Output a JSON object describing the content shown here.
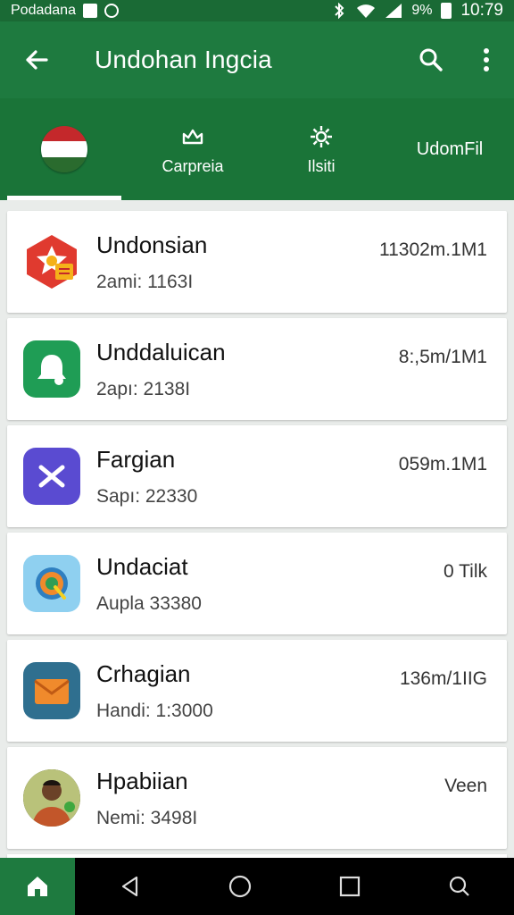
{
  "status_bar": {
    "carrier": "Podadana",
    "battery": "9%",
    "time": "10:79"
  },
  "app_bar": {
    "title": "Undohan Ingcia",
    "back_icon": "arrow-left-icon",
    "search_icon": "search-icon",
    "menu_icon": "more-vert-icon"
  },
  "tabs": [
    {
      "label": "",
      "icon": "flag-icon",
      "active": true
    },
    {
      "label": "Carpreia",
      "icon": "crown-icon",
      "active": false
    },
    {
      "label": "Ilsiti",
      "icon": "gear-icon",
      "active": false
    },
    {
      "label": "UdomFil",
      "icon": "",
      "active": false
    }
  ],
  "items": [
    {
      "name": "Undonsian",
      "sub": "2ami: 1163I",
      "value": "11302m.1M1",
      "icon": "star-badge-icon",
      "color": "#e03a2f"
    },
    {
      "name": "Unddaluican",
      "sub": "2apı: 2138I",
      "value": "8:,5m/1M1",
      "icon": "bell-icon",
      "color": "#1f9d55"
    },
    {
      "name": "Fargian",
      "sub": "Sapı: 22330",
      "value": "059m.1M1",
      "icon": "cross-arrow-icon",
      "color": "#5a4bd1"
    },
    {
      "name": "Undaciat",
      "sub": "Aupla 33380",
      "value": "0 Tilk",
      "icon": "target-icon",
      "color": "#5bb7e6"
    },
    {
      "name": "Crhagian",
      "sub": "Handi: 1:3000",
      "value": "136m/1IIG",
      "icon": "envelope-icon",
      "color": "#2f6f8f"
    },
    {
      "name": "Hpabiian",
      "sub": "Nemi: 3498I",
      "value": "Veen",
      "icon": "avatar-photo",
      "color": "#3a3a2a"
    }
  ],
  "colors": {
    "primary": "#1e7a3f",
    "primary_dark": "#1a6a35"
  },
  "nav": {
    "home": "home-icon",
    "back": "nav-back-icon",
    "home_circle": "nav-home-circle-icon",
    "recents": "nav-recents-icon",
    "assist": "nav-assist-icon"
  }
}
